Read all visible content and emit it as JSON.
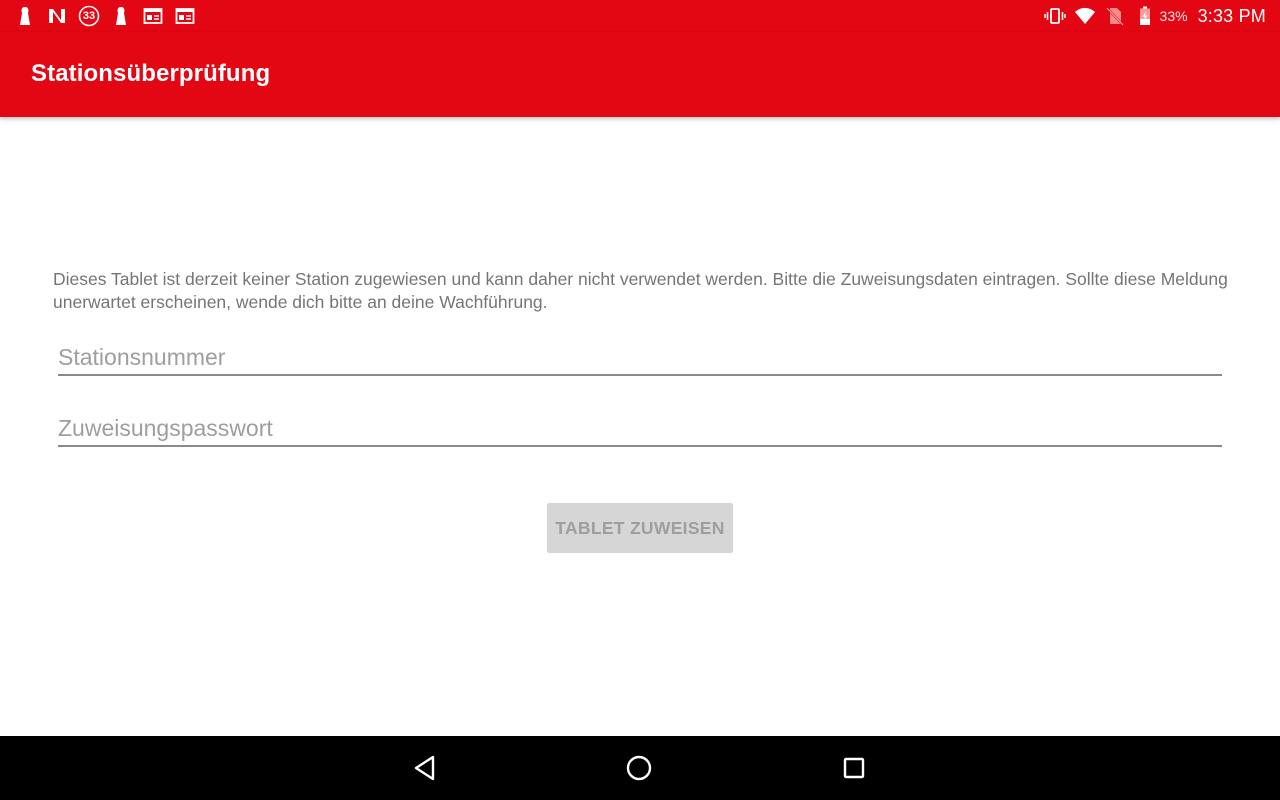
{
  "status_bar": {
    "notification_icons": [
      "person-icon",
      "netflix-icon",
      "badge-33-icon",
      "person-icon",
      "calendar-icon",
      "calendar-icon"
    ],
    "badge_number": "33",
    "right_icons": [
      "vibrate-icon",
      "wifi-icon",
      "no-sim-icon",
      "battery-charging-icon"
    ],
    "battery_percent": "33%",
    "time": "3:33 PM"
  },
  "app_bar": {
    "title": "Stationsüberprüfung"
  },
  "main": {
    "message": "Dieses Tablet ist derzeit keiner Station zugewiesen und kann daher nicht verwendet werden. Bitte die Zuweisungsdaten eintragen. Sollte diese Meldung unerwartet erscheinen, wende dich bitte an deine Wachführung.",
    "station_field": {
      "value": "",
      "placeholder": "Stationsnummer"
    },
    "password_field": {
      "value": "",
      "placeholder": "Zuweisungspasswort"
    },
    "assign_button_label": "TABLET ZUWEISEN"
  },
  "nav_bar": {
    "buttons": [
      "back-icon",
      "home-icon",
      "recent-apps-icon"
    ]
  },
  "colors": {
    "brand_red": "#e30613",
    "text_gray": "#757575",
    "disabled_button": "#d6d6d6"
  }
}
